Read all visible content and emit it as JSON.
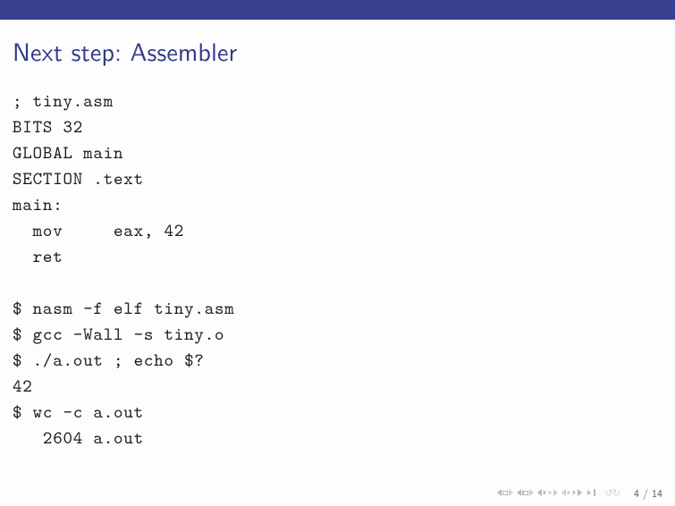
{
  "title": "Next step: Assembler",
  "code": "; tiny.asm\nBITS 32\nGLOBAL main\nSECTION .text\nmain:\n  mov     eax, 42\n  ret\n\n$ nasm -f elf tiny.asm\n$ gcc -Wall -s tiny.o\n$ ./a.out ; echo $?\n42\n$ wc -c a.out\n   2604 a.out",
  "footer": {
    "page_current": "4",
    "page_sep": " / ",
    "page_total": "14"
  }
}
